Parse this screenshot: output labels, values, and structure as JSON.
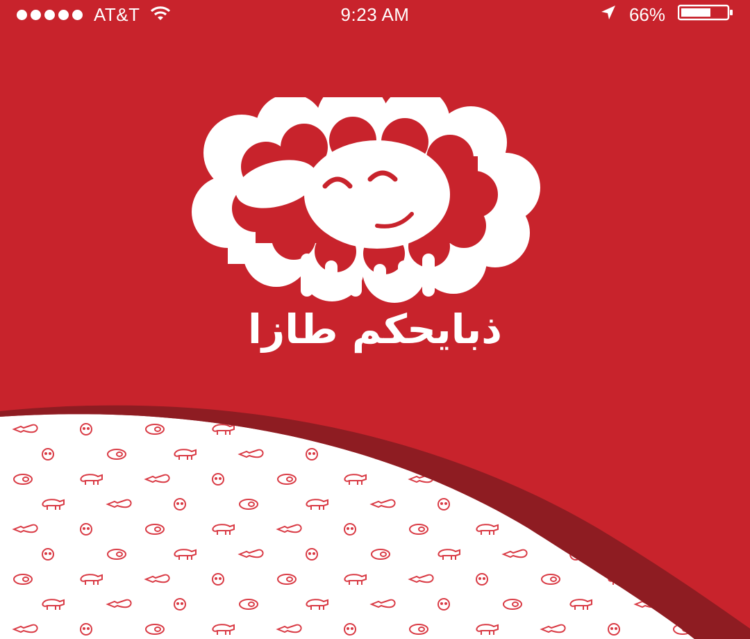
{
  "status_bar": {
    "carrier": "AT&T",
    "time": "9:23 AM",
    "battery_percent": "66%",
    "battery_level": 0.66,
    "icons": [
      "signal-dots-icon",
      "wifi-icon",
      "location-arrow-icon",
      "battery-icon"
    ]
  },
  "brand": {
    "name": "ذبايحكم طازا",
    "logo": "sheep-logo-icon"
  },
  "colors": {
    "primary_red": "#C8232C",
    "dark_red": "#8E1C22",
    "white": "#FFFFFF",
    "pattern_red": "#D93A44"
  },
  "pattern_icons": [
    "lamb-leg-icon",
    "sheep-face-icon",
    "steak-icon",
    "sheep-icon"
  ]
}
